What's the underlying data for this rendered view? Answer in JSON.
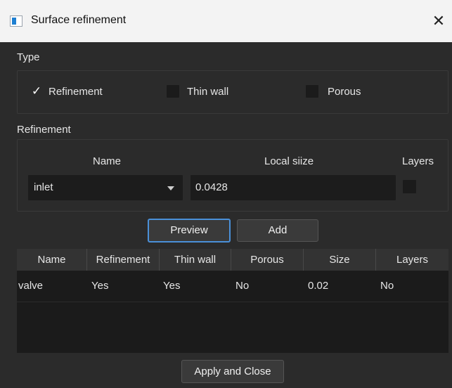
{
  "window": {
    "title": "Surface refinement",
    "close_glyph": "✕",
    "app_icon": "window-icon"
  },
  "type_group": {
    "title": "Type",
    "options": [
      {
        "label": "Refinement",
        "checked": true
      },
      {
        "label": "Thin wall",
        "checked": false
      },
      {
        "label": "Porous",
        "checked": false
      }
    ],
    "check_glyph": "✓"
  },
  "refinement_group": {
    "title": "Refinement",
    "name_header": "Name",
    "local_size_header": "Local siize",
    "layers_header": "Layers",
    "name_value": "inlet",
    "local_size_value": "0.0428",
    "layers_checked": false
  },
  "buttons": {
    "preview": "Preview",
    "add": "Add",
    "apply_close": "Apply and Close"
  },
  "table": {
    "columns": [
      "Name",
      "Refinement",
      "Thin wall",
      "Porous",
      "Size",
      "Layers"
    ],
    "rows": [
      [
        "valve",
        "Yes",
        "Yes",
        "No",
        "0.02",
        "No"
      ]
    ]
  },
  "colors": {
    "background": "#2b2b2b",
    "field": "#1c1c1c",
    "focus": "#4a90d9",
    "titlebar": "#f3f3f3"
  }
}
